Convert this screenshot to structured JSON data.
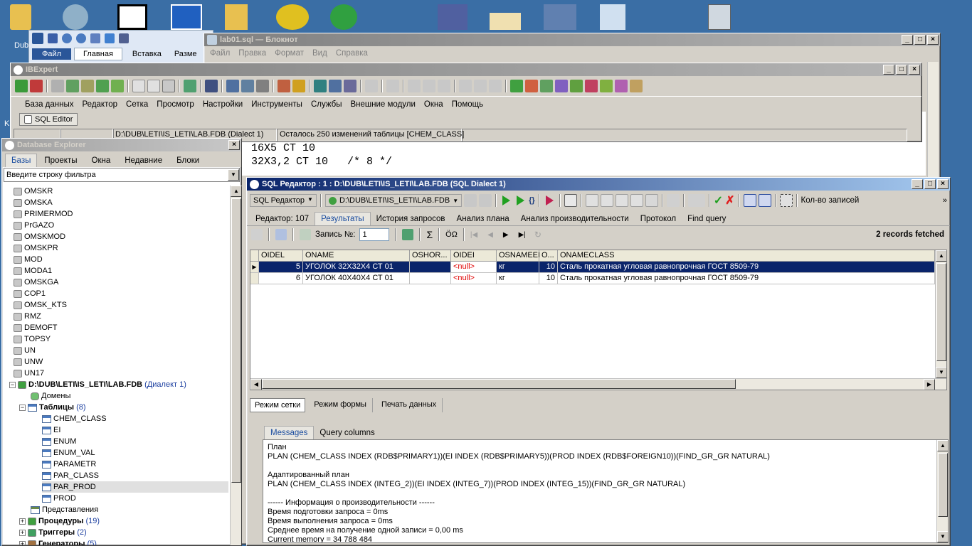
{
  "desktop": {
    "left_label": "Dub",
    "left_label2": "K"
  },
  "word": {
    "tab_file": "Файл",
    "tab_home": "Главная",
    "tab_insert": "Вставка",
    "tab_layout": "Разме"
  },
  "notepad": {
    "title": "lab01.sql — Блокнот",
    "menu": [
      "Файл",
      "Правка",
      "Формат",
      "Вид",
      "Справка"
    ],
    "line1": "  16Х5 СТ 10",
    "line2": "  32Х3,2 СТ 10   /* 8 */"
  },
  "ibexpert": {
    "title": "IBExpert",
    "menu": [
      "База данных",
      "Редактор",
      "Сетка",
      "Просмотр",
      "Настройки",
      "Инструменты",
      "Службы",
      "Внешние модули",
      "Окна",
      "Помощь"
    ],
    "sql_tab": "SQL Editor",
    "status_db": "D:\\DUB\\LETI\\IS_LETI\\LAB.FDB (Dialect 1)",
    "status_changes": "Осталось 250 изменений таблицы [CHEM_CLASS]"
  },
  "explorer": {
    "title": "Database Explorer",
    "tabs": [
      "Базы",
      "Проекты",
      "Окна",
      "Недавние",
      "Блоки"
    ],
    "filter_placeholder": "Введите строку фильтра",
    "databases": [
      "OMSKR",
      "OMSKA",
      "PRIMERMOD",
      "PrGAZO",
      "OMSKMOD",
      "OMSKPR",
      "MOD",
      "MODA1",
      "OMSKGA",
      "COP1",
      "OMSK_KTS",
      "RMZ",
      "DEMOFT",
      "TOPSY",
      "UN",
      "UNW",
      "UN17"
    ],
    "active_db": "D:\\DUB\\LETI\\IS_LETI\\LAB.FDB",
    "active_db_dialect": "(Диалект 1)",
    "domains": "Домены",
    "tables_label": "Таблицы",
    "tables_count": "(8)",
    "tables": [
      "CHEM_CLASS",
      "EI",
      "ENUM",
      "ENUM_VAL",
      "PARAMETR",
      "PAR_CLASS",
      "PAR_PROD",
      "PROD"
    ],
    "views": "Представления",
    "procedures_label": "Процедуры",
    "procedures_count": "(19)",
    "triggers_label": "Триггеры",
    "triggers_count": "(2)",
    "generators_label": "Генераторы",
    "generators_count": "(5)"
  },
  "sql": {
    "title": "SQL Редактор : 1 : D:\\DUB\\LETI\\IS_LETI\\LAB.FDB (SQL Dialect 1)",
    "dropdown1": "SQL Редактор",
    "dropdown2": "D:\\DUB\\LETI\\IS_LETI\\LAB.FDB",
    "rows_label": "Кол-во записей",
    "tabs": [
      "Редактор: 107",
      "Результаты",
      "История запросов",
      "Анализ плана",
      "Анализ производительности",
      "Протокол",
      "Find query"
    ],
    "record_label": "Запись №:",
    "record_value": "1",
    "fetched": "2 records fetched",
    "columns": [
      "OIDEL",
      "ONAME",
      "OSHOR...",
      "OIDEI",
      "OSNAMEEI",
      "O...",
      "ONAMECLASS"
    ],
    "rows": [
      [
        "5",
        "УГОЛОК 32Х32Х4 СТ 01",
        "",
        "<null>",
        "кг",
        "10",
        "Сталь прокатная угловая равнопрочная ГОСТ 8509-79"
      ],
      [
        "6",
        "УГОЛОК 40Х40Х4 СТ 01",
        "",
        "<null>",
        "кг",
        "10",
        "Сталь прокатная угловая равнопрочная ГОСТ 8509-79"
      ]
    ],
    "mode_tabs": [
      "Режим сетки",
      "Режим формы",
      "Печать данных"
    ],
    "msg_tabs": [
      "Messages",
      "Query columns"
    ],
    "messages": [
      "План",
      "PLAN (CHEM_CLASS INDEX (RDB$PRIMARY1))(EI INDEX (RDB$PRIMARY5))(PROD INDEX (RDB$FOREIGN10))(FIND_GR_GR NATURAL)",
      "",
      "Адаптированный план",
      "PLAN (CHEM_CLASS INDEX (INTEG_2))(EI INDEX (INTEG_7))(PROD INDEX (INTEG_15))(FIND_GR_GR NATURAL)",
      "",
      "------ Информация о производительности ------",
      "Время подготовки запроса = 0ms",
      "Время выполнения запроса = 0ms",
      "Среднее время на получение одной записи = 0,00 ms",
      "Current memory = 34 788 484"
    ]
  }
}
